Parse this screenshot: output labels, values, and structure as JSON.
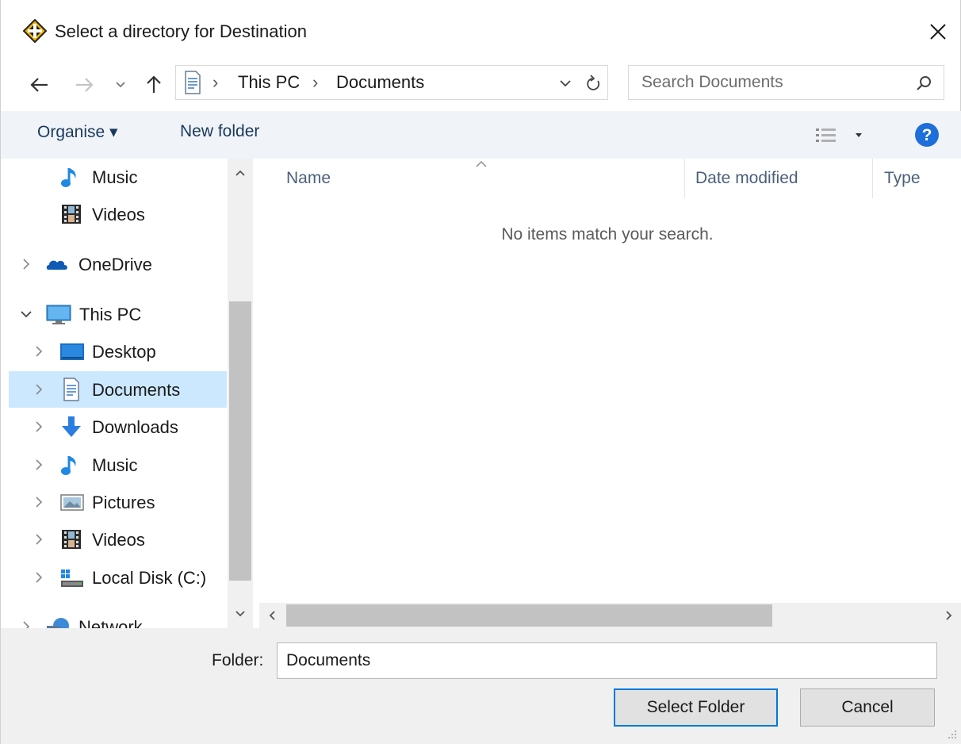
{
  "window": {
    "title": "Select a directory for Destination"
  },
  "address": {
    "crumbs": [
      "This PC",
      "Documents"
    ],
    "separator": "›"
  },
  "search": {
    "placeholder": "Search Documents"
  },
  "toolbar": {
    "organise_label": "Organise ▾",
    "new_folder_label": "New folder"
  },
  "nav": {
    "items": [
      {
        "label": "Music",
        "icon": "music-icon"
      },
      {
        "label": "Videos",
        "icon": "videos-icon"
      },
      {
        "label": "OneDrive",
        "icon": "onedrive-icon"
      },
      {
        "label": "This PC",
        "icon": "this-pc-icon"
      },
      {
        "label": "Desktop",
        "icon": "desktop-icon"
      },
      {
        "label": "Documents",
        "icon": "documents-icon"
      },
      {
        "label": "Downloads",
        "icon": "downloads-icon"
      },
      {
        "label": "Music",
        "icon": "music-icon"
      },
      {
        "label": "Pictures",
        "icon": "pictures-icon"
      },
      {
        "label": "Videos",
        "icon": "videos-icon"
      },
      {
        "label": "Local Disk (C:)",
        "icon": "local-disk-icon"
      },
      {
        "label": "Network",
        "icon": "network-icon"
      }
    ],
    "selected": "Documents"
  },
  "content": {
    "columns": [
      "Name",
      "Date modified",
      "Type"
    ],
    "empty_message": "No items match your search."
  },
  "bottom": {
    "folder_label": "Folder:",
    "folder_value": "Documents",
    "select_button": "Select Folder",
    "cancel_button": "Cancel"
  },
  "colors": {
    "accent": "#0078d7",
    "selected_bg": "#cce8ff",
    "toolbar_bg": "#f0f4f9",
    "help_blue": "#1e6fd9"
  }
}
